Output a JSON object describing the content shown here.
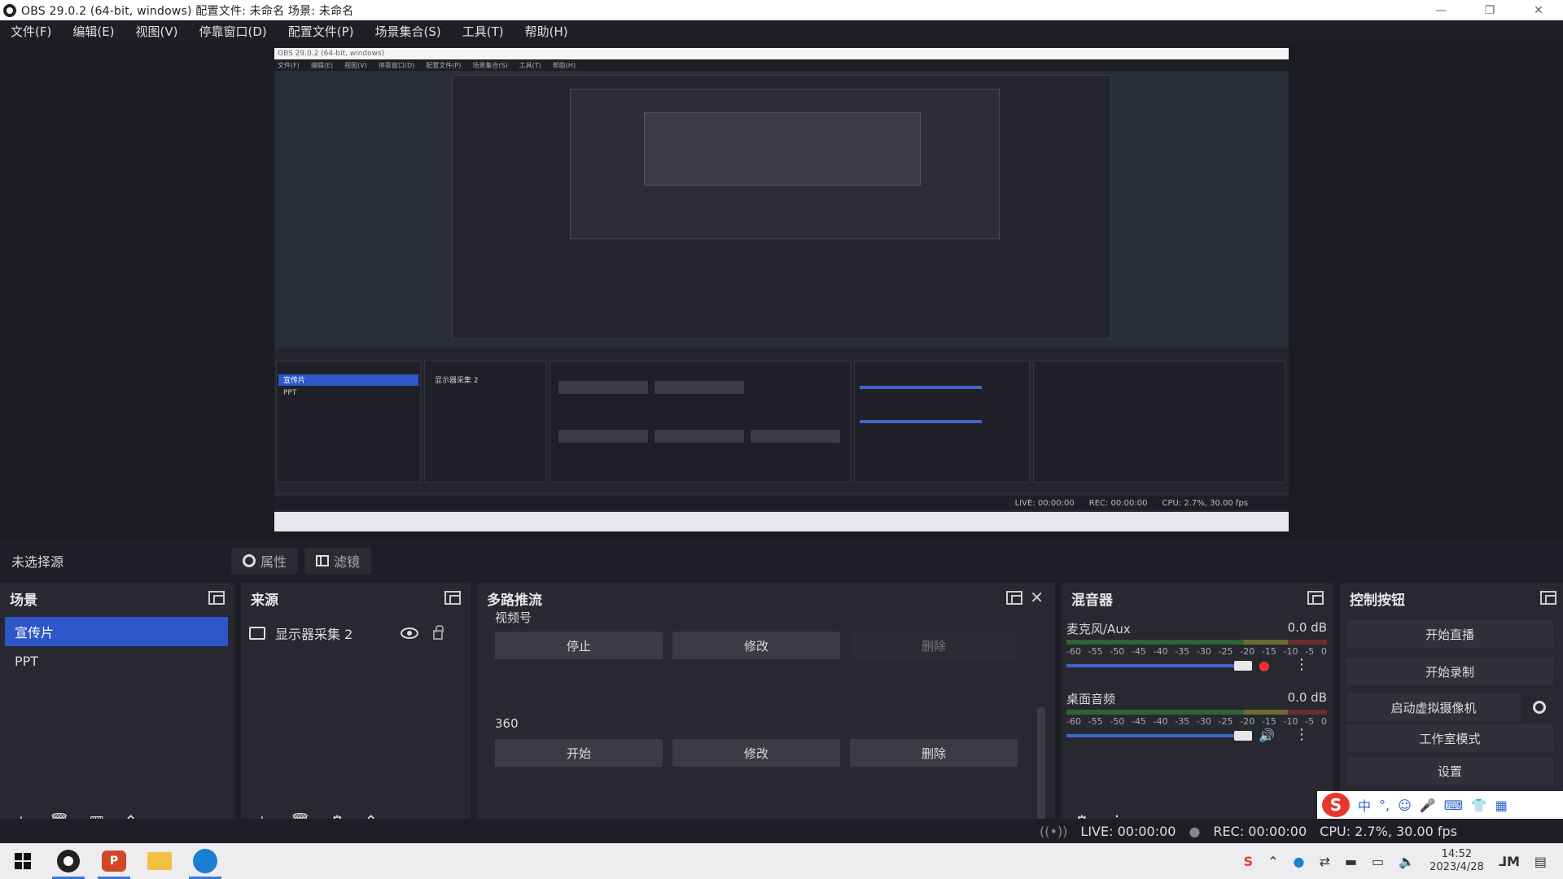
{
  "window": {
    "title": "OBS 29.0.2 (64-bit, windows)  配置文件: 未命名  场景: 未命名",
    "minimize": "—",
    "maximize": "❐",
    "close": "✕"
  },
  "menu": [
    "文件(F)",
    "编辑(E)",
    "视图(V)",
    "停靠窗口(D)",
    "配置文件(P)",
    "场景集合(S)",
    "工具(T)",
    "帮助(H)"
  ],
  "toolbar": {
    "no_source": "未选择源",
    "properties": "属性",
    "filters": "滤镜"
  },
  "scenes": {
    "title": "场景",
    "items": [
      {
        "label": "宣传片",
        "selected": true
      },
      {
        "label": "PPT",
        "selected": false
      }
    ]
  },
  "sources": {
    "title": "来源",
    "items": [
      {
        "label": "显示器采集 2"
      }
    ]
  },
  "multistream": {
    "title": "多路推流",
    "groups": [
      {
        "name": "视频号",
        "buttons": [
          "停止",
          "修改",
          "删除"
        ]
      },
      {
        "name": "360",
        "buttons": [
          "开始",
          "修改",
          "删除"
        ]
      }
    ]
  },
  "mixer": {
    "title": "混音器",
    "scale": [
      "-60",
      "-55",
      "-50",
      "-45",
      "-40",
      "-35",
      "-30",
      "-25",
      "-20",
      "-15",
      "-10",
      "-5",
      "0"
    ],
    "channels": [
      {
        "name": "麦克风/Aux",
        "db": "0.0 dB",
        "level": 1.0
      },
      {
        "name": "桌面音频",
        "db": "0.0 dB",
        "level": 1.0
      }
    ]
  },
  "controls": {
    "title": "控制按钮",
    "start_stream": "开始直播",
    "start_record": "开始录制",
    "virtual_cam": "启动虚拟摄像机",
    "studio_mode": "工作室模式",
    "settings": "设置"
  },
  "ime": {
    "logo": "S",
    "lang": "中",
    "items": [
      "°,",
      "☺",
      "🎤",
      "⌨",
      "👕",
      "▦"
    ]
  },
  "status": {
    "live": "LIVE: 00:00:00",
    "rec": "REC: 00:00:00",
    "cpu": "CPU: 2.7%, 30.00 fps"
  },
  "taskbar": {
    "ppt": "P",
    "time": "14:52",
    "date": "2023/4/28"
  },
  "preview": {
    "title": "OBS 29.0.2 (64-bit, windows)",
    "menu": [
      "文件(F)",
      "编辑(E)",
      "视图(V)",
      "停靠窗口(D)",
      "配置文件(P)",
      "场景集合(S)",
      "工具(T)",
      "帮助(H)"
    ],
    "scene1": "宣传片",
    "scene2": "PPT",
    "source": "显示器采集 2",
    "status_live": "LIVE: 00:00:00",
    "status_rec": "REC: 00:00:00",
    "status_cpu": "CPU: 2.7%, 30.00 fps"
  }
}
